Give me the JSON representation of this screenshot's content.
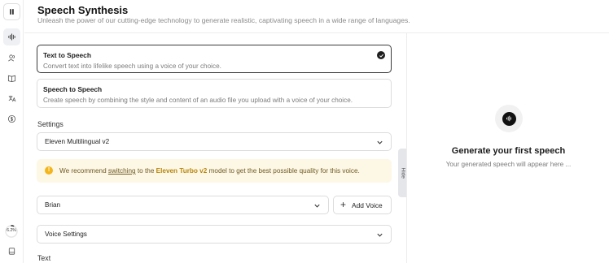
{
  "header": {
    "title": "Speech Synthesis",
    "subtitle": "Unleash the power of our cutting-edge technology to generate realistic, captivating speech in a wide range of languages."
  },
  "modes": [
    {
      "title": "Text to Speech",
      "description": "Convert text into lifelike speech using a voice of your choice.",
      "selected": true
    },
    {
      "title": "Speech to Speech",
      "description": "Create speech by combining the style and content of an audio file you upload with a voice of your choice.",
      "selected": false
    }
  ],
  "settings": {
    "label": "Settings",
    "model_selected": "Eleven Multilingual v2"
  },
  "banner": {
    "prefix": "We recommend ",
    "link": "switching",
    "middle": " to the ",
    "model": "Eleven Turbo v2",
    "suffix": " model to get the best possible quality for this voice."
  },
  "voice": {
    "selected": "Brian",
    "add_label": "Add Voice",
    "settings_label": "Voice Settings"
  },
  "text_section": {
    "label": "Text"
  },
  "hide_tab": {
    "label": "Hide"
  },
  "output": {
    "title": "Generate your first speech",
    "subtitle": "Your generated speech will appear here ..."
  },
  "sidebar": {
    "usage_text": "6.2%",
    "usage_fraction": 0.062,
    "icons": [
      "logo-icon",
      "waveform-icon",
      "users-icon",
      "book-icon",
      "translate-icon",
      "dollar-icon",
      "library-icon"
    ]
  },
  "colors": {
    "accent": "#f3b51b",
    "banner_bg": "#fdf7e6",
    "model_link": "#b7860b"
  }
}
